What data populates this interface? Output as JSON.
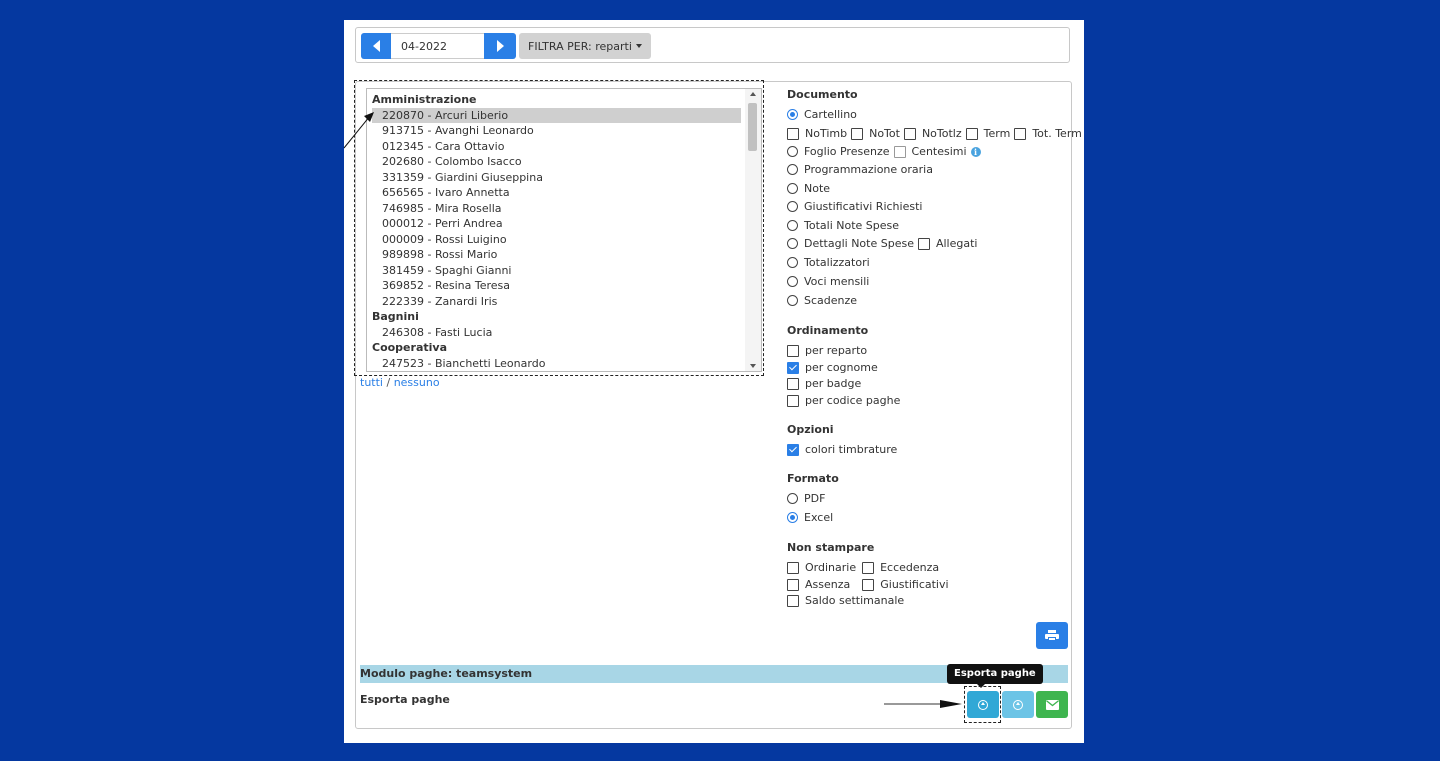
{
  "toolbar": {
    "month_value": "04-2022",
    "filter_label": "FILTRA PER: reparti"
  },
  "employees": {
    "groups": [
      {
        "name": "Amministrazione",
        "items": [
          "220870 - Arcuri Liberio",
          "913715 - Avanghi Leonardo",
          "012345 - Cara Ottavio",
          "202680 - Colombo Isacco",
          "331359 - Giardini Giuseppina",
          "656565 - Ivaro Annetta",
          "746985 - Mira Rosella",
          "000012 - Perri Andrea",
          "000009 - Rossi Luigino",
          "989898 - Rossi Mario",
          "381459 - Spaghi Gianni",
          "369852 - Resina Teresa",
          "222339 - Zanardi Iris"
        ]
      },
      {
        "name": "Bagnini",
        "items": [
          "246308 - Fasti Lucia"
        ]
      },
      {
        "name": "Cooperativa",
        "items": [
          "247523 - Bianchetti Leonardo"
        ]
      }
    ],
    "selected": "220870 - Arcuri Liberio",
    "link_all": "tutti",
    "link_sep": "/",
    "link_none": "nessuno"
  },
  "documento": {
    "title": "Documento",
    "cartellino": "Cartellino",
    "notimb": "NoTimb",
    "notot": "NoTot",
    "nototlz": "NoTotlz",
    "term": "Term",
    "totterm": "Tot. Term",
    "foglio": "Foglio Presenze",
    "centesimi": "Centesimi",
    "programmazione": "Programmazione oraria",
    "note": "Note",
    "giustificativi": "Giustificativi Richiesti",
    "totali_note": "Totali Note Spese",
    "dettagli_note": "Dettagli Note Spese",
    "allegati": "Allegati",
    "totalizzatori": "Totalizzatori",
    "voci": "Voci mensili",
    "scadenze": "Scadenze",
    "selected": "Cartellino"
  },
  "ordinamento": {
    "title": "Ordinamento",
    "reparto": "per reparto",
    "cognome": "per cognome",
    "badge": "per badge",
    "codice": "per codice paghe",
    "checked": [
      "per cognome"
    ]
  },
  "opzioni": {
    "title": "Opzioni",
    "colori": "colori timbrature",
    "checked": [
      "colori timbrature"
    ]
  },
  "formato": {
    "title": "Formato",
    "pdf": "PDF",
    "excel": "Excel",
    "selected": "Excel"
  },
  "non_stampare": {
    "title": "Non stampare",
    "ordinarie": "Ordinarie",
    "eccedenza": "Eccedenza",
    "assenza": "Assenza",
    "giustificativi": "Giustificativi",
    "saldo": "Saldo settimanale"
  },
  "paghe": {
    "module_label": "Modulo paghe: teamsystem",
    "export_label": "Esporta paghe",
    "tooltip": "Esporta paghe"
  },
  "icons": {
    "prev": "caret-left-icon",
    "next": "caret-right-icon",
    "print": "printer-icon",
    "export": "circle-arrow-up-icon",
    "mail": "envelope-icon",
    "info": "info-icon"
  },
  "colors": {
    "background": "#0538a0",
    "primary": "#2a7fe6",
    "info": "#31a8d6",
    "success": "#3fb54f",
    "module_bar": "#a8d6e6"
  }
}
